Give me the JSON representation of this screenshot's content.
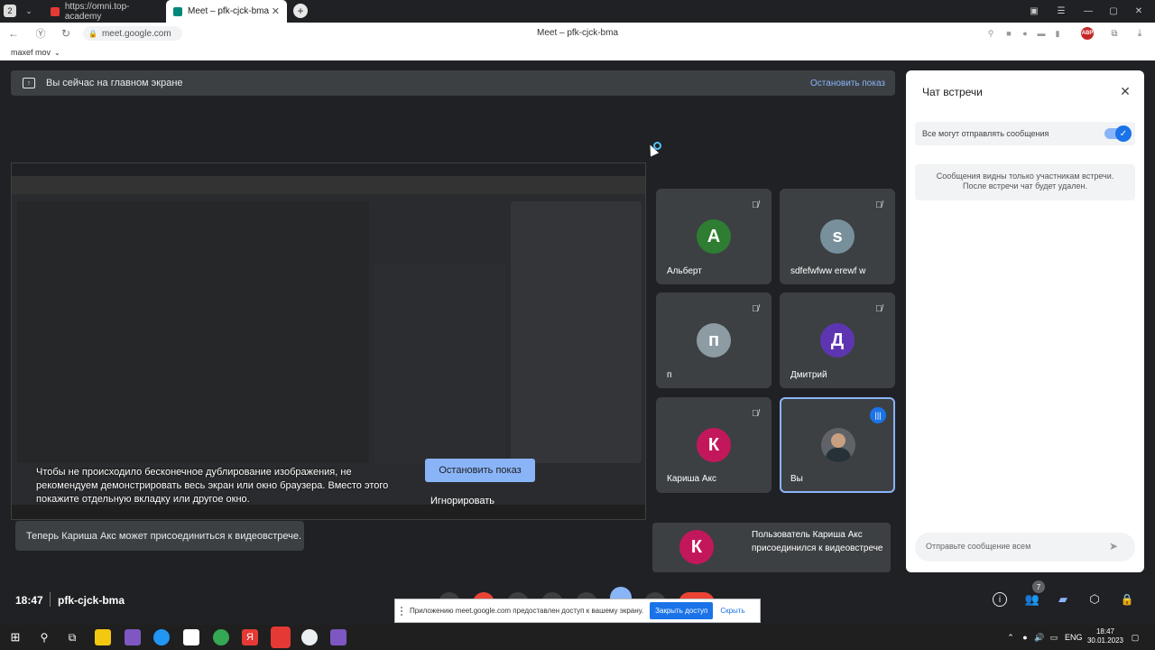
{
  "browser": {
    "tab_counter": "2",
    "tabs": [
      {
        "label": "https://omni.top-academy"
      },
      {
        "label": "Meet – pfk-cjck-bma"
      }
    ],
    "url": "meet.google.com",
    "page_title": "Meet – pfk-cjck-bma",
    "bookmark": "maxef mov"
  },
  "banner": {
    "text": "Вы сейчас на главном экране",
    "stop_label": "Остановить показ"
  },
  "participants": [
    {
      "initial": "А",
      "name": "Альберт",
      "color": "#2e7d32",
      "muted": true
    },
    {
      "initial": "s",
      "name": "sdfefwfww erewf w",
      "color": "#78909c",
      "muted": true
    },
    {
      "initial": "п",
      "name": "п",
      "color": "#8d9ba3",
      "muted": true
    },
    {
      "initial": "Д",
      "name": "Дмитрий",
      "color": "#5e35b1",
      "muted": true
    },
    {
      "initial": "К",
      "name": "Кариша Акс",
      "color": "#c2185b",
      "muted": true
    },
    {
      "initial": "",
      "name": "Вы",
      "color": "#5f6368",
      "muted": false
    }
  ],
  "warning": {
    "text": "Чтобы не происходило бесконечное дублирование изображения, не рекомендуем демонстрировать весь экран или окно браузера. Вместо этого покажите отдельную вкладку или другое окно.",
    "stop_button": "Остановить показ",
    "ignore_button": "Игнорировать"
  },
  "toast_left": "Теперь Кариша Акс может присоединиться к видеовстрече.",
  "toast_right": {
    "initial": "К",
    "text": "Пользователь Кариша Акс присоединился к видеовстрече"
  },
  "chat": {
    "title": "Чат встречи",
    "toggle_label": "Все могут отправлять сообщения",
    "info": "Сообщения видны только участникам встречи. После встречи чат будет удален.",
    "placeholder": "Отправьте сообщение всем"
  },
  "bottom": {
    "time": "18:47",
    "code": "pfk-cjck-bma",
    "people_badge": "7"
  },
  "sharebar": {
    "text": "Приложению meet.google.com предоставлен доступ к вашему экрану.",
    "close_btn": "Закрыть доступ",
    "hide_btn": "Скрыть"
  },
  "taskbar": {
    "lang": "ENG",
    "time": "18:47",
    "date": "30.01.2023"
  }
}
